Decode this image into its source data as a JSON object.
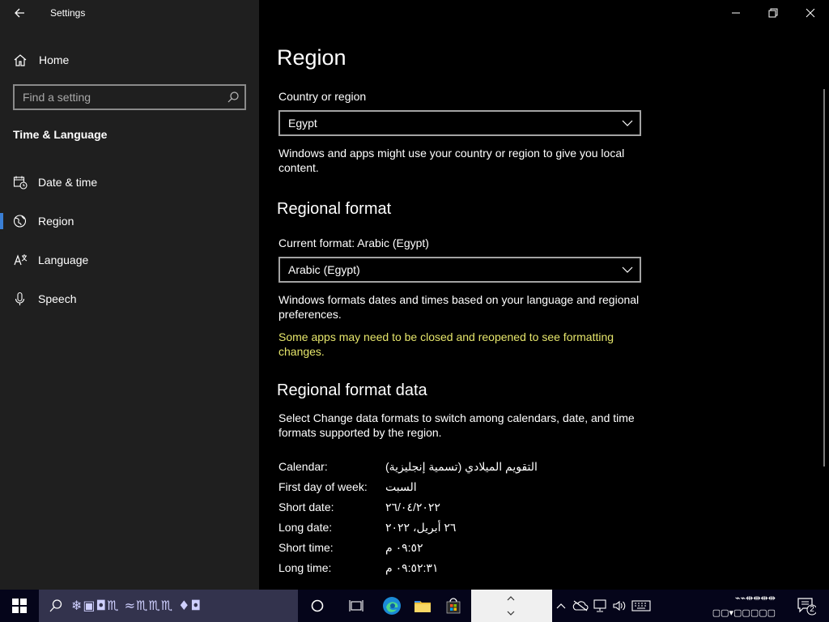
{
  "window": {
    "title": "Settings"
  },
  "sidebar": {
    "home_label": "Home",
    "search_placeholder": "Find a setting",
    "section_title": "Time & Language",
    "items": [
      {
        "label": "Date & time",
        "icon": "date-time-icon"
      },
      {
        "label": "Region",
        "icon": "globe-icon",
        "active": true
      },
      {
        "label": "Language",
        "icon": "language-icon"
      },
      {
        "label": "Speech",
        "icon": "microphone-icon"
      }
    ]
  },
  "main": {
    "title": "Region",
    "country": {
      "label": "Country or region",
      "value": "Egypt",
      "description": "Windows and apps might use your country or region to give you local content."
    },
    "regional_format": {
      "heading": "Regional format",
      "current_label": "Current format: Arabic (Egypt)",
      "value": "Arabic (Egypt)",
      "description": "Windows formats dates and times based on your language and regional preferences.",
      "warning": "Some apps may need to be closed and reopened to see formatting changes."
    },
    "format_data": {
      "heading": "Regional format data",
      "description": "Select Change data formats to switch among calendars, date, and time formats supported by the region.",
      "rows": [
        {
          "key": "Calendar:",
          "value": "التقويم الميلادي (تسمية إنجليزية)"
        },
        {
          "key": "First day of week:",
          "value": "السبت"
        },
        {
          "key": "Short date:",
          "value": "٢٦/٠٤/٢٠٢٢"
        },
        {
          "key": "Long date:",
          "value": "٢٦ أبريل، ٢٠٢٢"
        },
        {
          "key": "Short time:",
          "value": "٠٩:٥٢ م"
        },
        {
          "key": "Long time:",
          "value": "٠٩:٥٢:٣١ م"
        }
      ]
    }
  },
  "taskbar": {
    "search_text": "❄▣◘♏ ≈♏♏♏ ♦◘",
    "clock_time": "⌁⌁⇹⇹⇹⇹",
    "clock_date": "▢▢▾▢▢▢▢▢",
    "notification_count": "2"
  },
  "colors": {
    "sidebar_bg": "#1f1f1f",
    "main_bg": "#000000",
    "accent": "#3a7fd5",
    "warning": "#e6e66b",
    "taskbar_bg": "#05051a"
  }
}
